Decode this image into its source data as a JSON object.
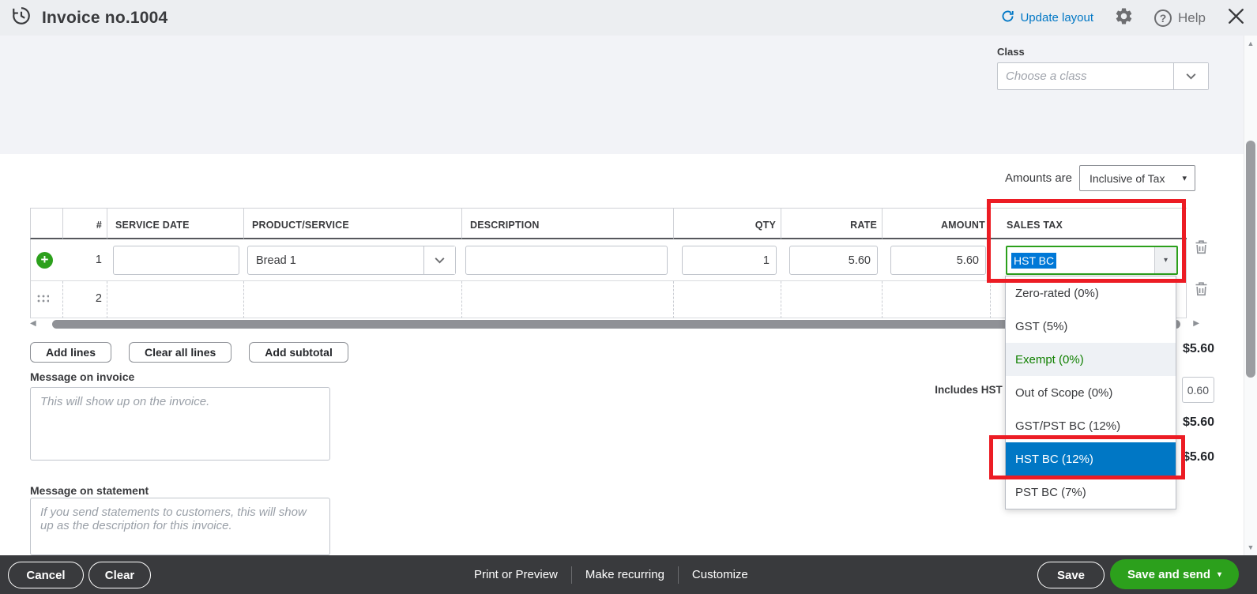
{
  "colors": {
    "accent_blue": "#0077c5",
    "qb_green": "#2ca01c",
    "annotation_red": "#ec1c24",
    "footer_bg": "#393a3d",
    "selection_blue": "#0078d7",
    "exempt_green": "#108000",
    "topbar_bg": "#eceef1",
    "band_bg": "#f2f3f7"
  },
  "icons": {
    "history": "clock-with-circular-arrow",
    "refresh": "circular-arrow",
    "gear": "gear",
    "help": "?",
    "close": "✕",
    "chevron_down": "chevron-down",
    "dropdown_arrow": "▾",
    "plus": "+",
    "trash": "trash-can",
    "drag_handle": "dot-grid",
    "scroll_left": "◀",
    "scroll_right": "▶",
    "scroll_up": "▲",
    "scroll_down": "▼"
  },
  "header": {
    "title": "Invoice no.1004",
    "update_layout": "Update layout",
    "help": "Help"
  },
  "class_field": {
    "label": "Class",
    "placeholder": "Choose a class"
  },
  "amounts_bar": {
    "label": "Amounts are",
    "value": "Inclusive of Tax"
  },
  "line_items": {
    "columns": {
      "num": "#",
      "service_date": "SERVICE DATE",
      "product": "PRODUCT/SERVICE",
      "description": "DESCRIPTION",
      "qty": "QTY",
      "rate": "RATE",
      "amount": "AMOUNT",
      "sales_tax": "SALES TAX"
    },
    "row1": {
      "num": "1",
      "service_date": "",
      "product": "Bread 1",
      "description": "",
      "qty": "1",
      "rate": "5.60",
      "amount": "5.60",
      "sales_tax": "HST BC"
    },
    "row2": {
      "num": "2"
    }
  },
  "actions": {
    "add_lines": "Add lines",
    "clear_all_lines": "Clear all lines",
    "add_subtotal": "Add subtotal"
  },
  "message_on_invoice": {
    "label": "Message on invoice",
    "placeholder": "This will show up on the invoice."
  },
  "message_on_statement": {
    "label": "Message on statement",
    "placeholder": "If you send statements to customers, this will show up as the description for this invoice."
  },
  "totals": {
    "subtotal": "$5.60",
    "includes_tax_label": "Includes HST (",
    "tax_amount": "0.60",
    "total": "$5.60",
    "balance_due": "$5.60"
  },
  "tax_menu": {
    "options": [
      {
        "label": "Zero-rated (0%)"
      },
      {
        "label": "GST (5%)"
      },
      {
        "label": "Exempt (0%)"
      },
      {
        "label": "Out of Scope (0%)"
      },
      {
        "label": "GST/PST BC (12%)"
      },
      {
        "label": "HST BC (12%)"
      },
      {
        "label": "PST BC (7%)"
      }
    ],
    "selected": "HST BC (12%)"
  },
  "footer": {
    "cancel": "Cancel",
    "clear": "Clear",
    "print_or_preview": "Print or Preview",
    "make_recurring": "Make recurring",
    "customize": "Customize",
    "save": "Save",
    "save_and_send": "Save and send"
  }
}
